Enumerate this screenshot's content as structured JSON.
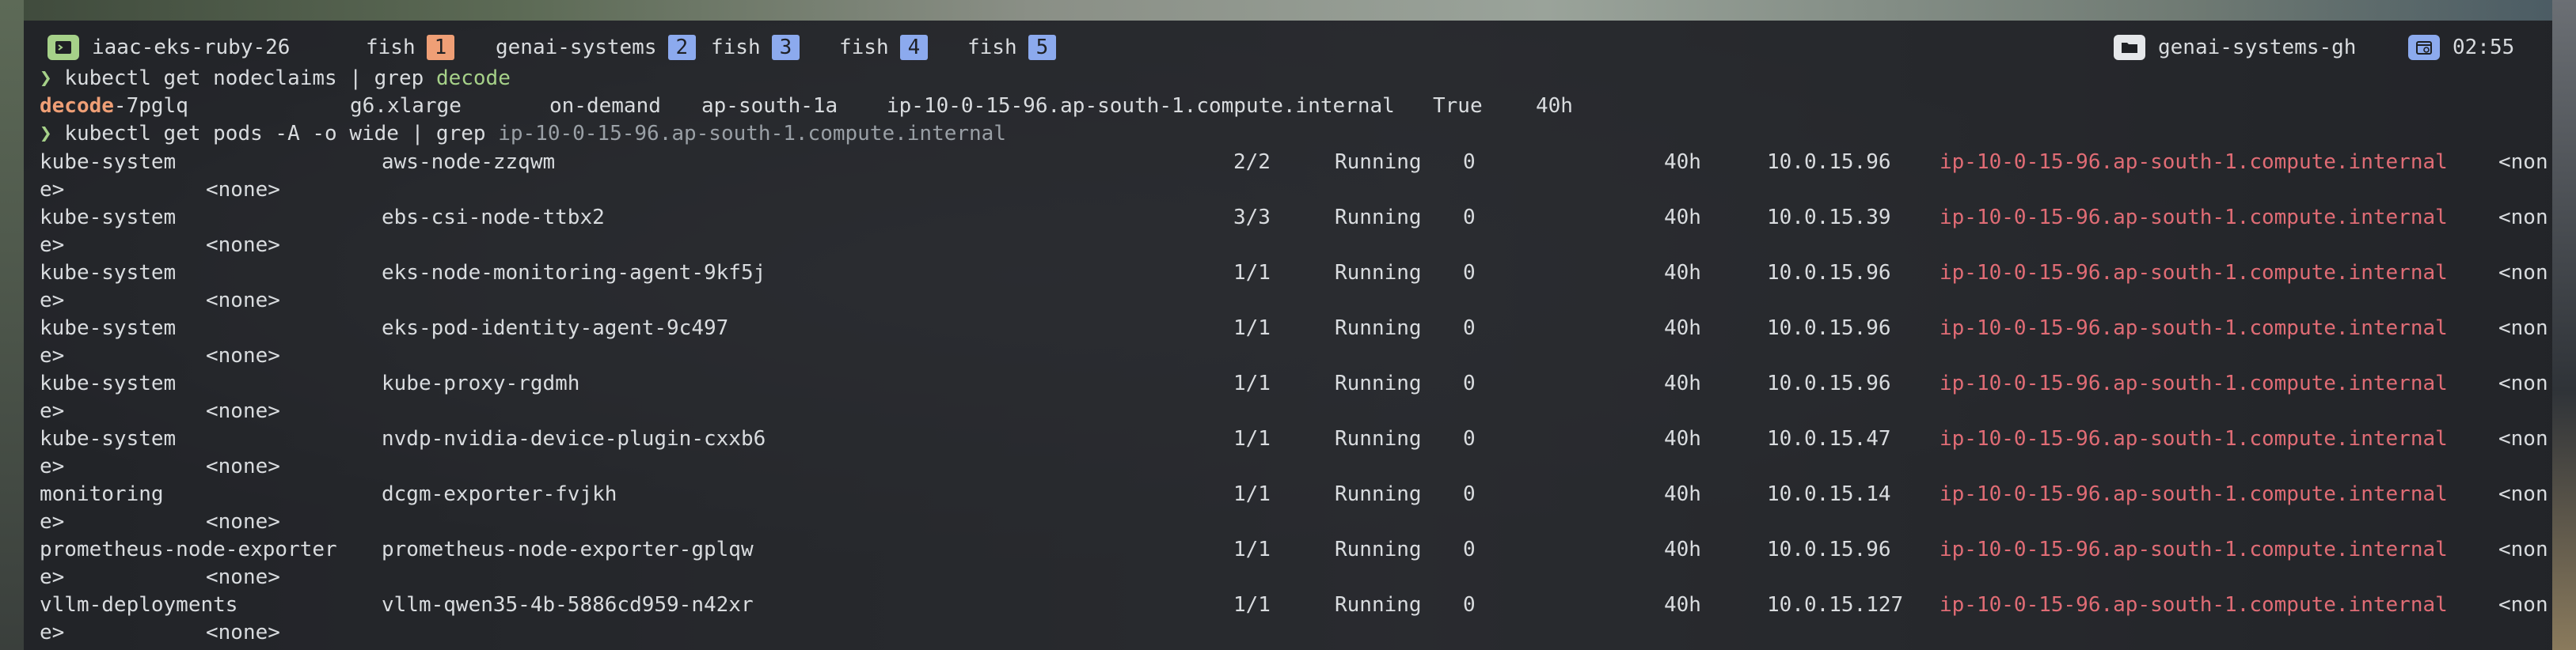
{
  "tabbar": {
    "session_name": "iaac-eks-ruby-26",
    "tabs": [
      {
        "label": "fish",
        "num": "1",
        "color": "#ef9f76"
      },
      {
        "label": "genai-systems",
        "num": "2",
        "color": "#8caaee"
      },
      {
        "label": "fish",
        "num": "3",
        "color": "#8caaee"
      },
      {
        "label": "fish",
        "num": "4",
        "color": "#8caaee"
      },
      {
        "label": "fish",
        "num": "5",
        "color": "#8caaee"
      }
    ],
    "folder_label": "genai-systems-gh",
    "clock": "02:55"
  },
  "command1": {
    "prompt": "❯",
    "cmd": "kubectl get nodeclaims |",
    "grep": "grep",
    "arg": "decode"
  },
  "nodeclaim": {
    "name_hl": "decode",
    "name_rest": "-7pglq",
    "type": "g6.xlarge",
    "capacity": "on-demand",
    "zone": "ap-south-1a",
    "node": "ip-10-0-15-96.ap-south-1.compute.internal",
    "ready": "True",
    "age": "40h"
  },
  "command2": {
    "prompt": "❯",
    "cmd": "kubectl get pods -A -o wide |",
    "grep": "grep",
    "arg": "ip-10-0-15-96.ap-south-1.compute.internal"
  },
  "pods": [
    {
      "ns": "kube-system",
      "name": "aws-node-zzqwm",
      "ready": "2/2",
      "status": "Running",
      "restarts": "0",
      "age": "40h",
      "ip": "10.0.15.96",
      "node": "ip-10-0-15-96.ap-south-1.compute.internal",
      "nominated": "<non",
      "wrap": "e>",
      "gates": "<none>"
    },
    {
      "ns": "kube-system",
      "name": "ebs-csi-node-ttbx2",
      "ready": "3/3",
      "status": "Running",
      "restarts": "0",
      "age": "40h",
      "ip": "10.0.15.39",
      "node": "ip-10-0-15-96.ap-south-1.compute.internal",
      "nominated": "<non",
      "wrap": "e>",
      "gates": "<none>"
    },
    {
      "ns": "kube-system",
      "name": "eks-node-monitoring-agent-9kf5j",
      "ready": "1/1",
      "status": "Running",
      "restarts": "0",
      "age": "40h",
      "ip": "10.0.15.96",
      "node": "ip-10-0-15-96.ap-south-1.compute.internal",
      "nominated": "<non",
      "wrap": "e>",
      "gates": "<none>"
    },
    {
      "ns": "kube-system",
      "name": "eks-pod-identity-agent-9c497",
      "ready": "1/1",
      "status": "Running",
      "restarts": "0",
      "age": "40h",
      "ip": "10.0.15.96",
      "node": "ip-10-0-15-96.ap-south-1.compute.internal",
      "nominated": "<non",
      "wrap": "e>",
      "gates": "<none>"
    },
    {
      "ns": "kube-system",
      "name": "kube-proxy-rgdmh",
      "ready": "1/1",
      "status": "Running",
      "restarts": "0",
      "age": "40h",
      "ip": "10.0.15.96",
      "node": "ip-10-0-15-96.ap-south-1.compute.internal",
      "nominated": "<non",
      "wrap": "e>",
      "gates": "<none>"
    },
    {
      "ns": "kube-system",
      "name": "nvdp-nvidia-device-plugin-cxxb6",
      "ready": "1/1",
      "status": "Running",
      "restarts": "0",
      "age": "40h",
      "ip": "10.0.15.47",
      "node": "ip-10-0-15-96.ap-south-1.compute.internal",
      "nominated": "<non",
      "wrap": "e>",
      "gates": "<none>"
    },
    {
      "ns": "monitoring",
      "name": "dcgm-exporter-fvjkh",
      "ready": "1/1",
      "status": "Running",
      "restarts": "0",
      "age": "40h",
      "ip": "10.0.15.14",
      "node": "ip-10-0-15-96.ap-south-1.compute.internal",
      "nominated": "<non",
      "wrap": "e>",
      "gates": "<none>"
    },
    {
      "ns": "prometheus-node-exporter",
      "name": "prometheus-node-exporter-gplqw",
      "ready": "1/1",
      "status": "Running",
      "restarts": "0",
      "age": "40h",
      "ip": "10.0.15.96",
      "node": "ip-10-0-15-96.ap-south-1.compute.internal",
      "nominated": "<non",
      "wrap": "e>",
      "gates": "<none>"
    },
    {
      "ns": "vllm-deployments",
      "name": "vllm-qwen35-4b-5886cd959-n42xr",
      "ready": "1/1",
      "status": "Running",
      "restarts": "0",
      "age": "40h",
      "ip": "10.0.15.127",
      "node": "ip-10-0-15-96.ap-south-1.compute.internal",
      "nominated": "<non",
      "wrap": "e>",
      "gates": "<none>"
    }
  ]
}
